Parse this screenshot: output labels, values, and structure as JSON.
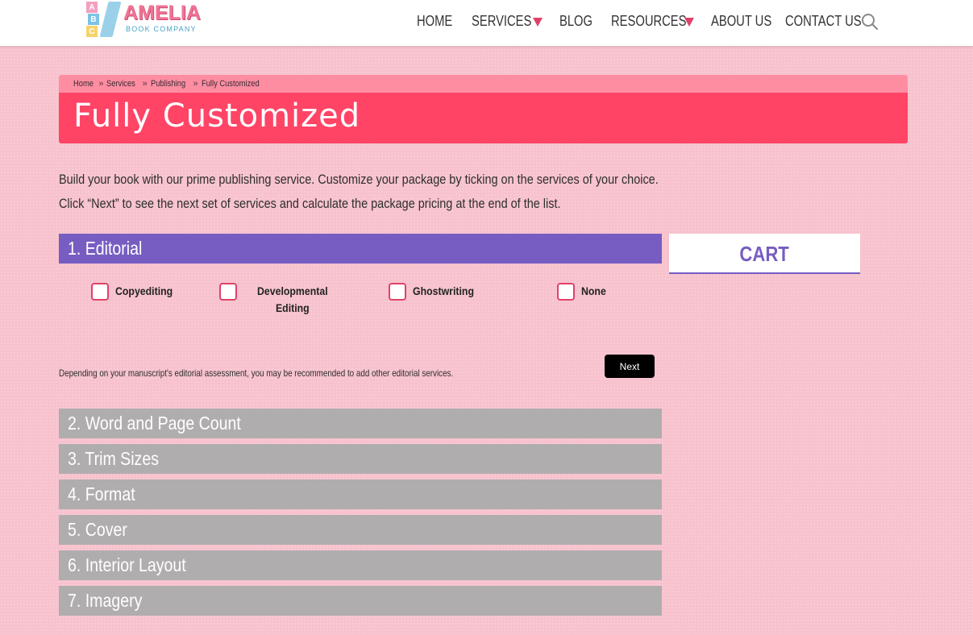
{
  "colors": {
    "page_bg": "#f7c2cd",
    "breadcrumb_bg": "#ff8da2",
    "title_bg": "#ff4466",
    "active_section": "#775dc2",
    "collapsed_section": "#b0adae",
    "caret": "#e0416a",
    "checkbox_border": "#e0416a"
  },
  "logo": {
    "blocks": [
      "A",
      "B",
      "C"
    ],
    "title": "AMELIA",
    "subtitle": "BOOK COMPANY"
  },
  "nav": {
    "items": [
      {
        "label": "HOME",
        "dropdown": false
      },
      {
        "label": "SERVICES",
        "dropdown": true
      },
      {
        "label": "BLOG",
        "dropdown": false
      },
      {
        "label": "RESOURCES",
        "dropdown": true
      },
      {
        "label": "ABOUT US",
        "dropdown": false
      },
      {
        "label": "CONTACT US",
        "dropdown": false
      }
    ],
    "search_icon": "search-icon"
  },
  "breadcrumb": {
    "items": [
      "Home",
      "Services",
      "Publishing",
      "Fully Customized"
    ],
    "separator": "»"
  },
  "page": {
    "title": "Fully Customized",
    "intro_line1": "Build your book with our prime publishing service. Customize your package by ticking on the services of your choice.",
    "intro_line2": "Click “Next” to see the next set of services and calculate the package pricing at the end of the list."
  },
  "sections": [
    {
      "label": "1. Editorial",
      "expanded": true,
      "options": [
        {
          "label": "Copyediting",
          "checked": false
        },
        {
          "label_line1": "Developmental",
          "label_line2": "Editing",
          "checked": false
        },
        {
          "label": "Ghostwriting",
          "checked": false
        },
        {
          "label": "None",
          "checked": false
        }
      ],
      "note": "Depending on your manuscript's editorial assessment, you may be recommended to add other editorial services.",
      "next_label": "Next"
    },
    {
      "label": "2. Word and Page Count",
      "expanded": false
    },
    {
      "label": "3. Trim Sizes",
      "expanded": false
    },
    {
      "label": "4. Format",
      "expanded": false
    },
    {
      "label": "5. Cover",
      "expanded": false
    },
    {
      "label": "6. Interior Layout",
      "expanded": false
    },
    {
      "label": "7. Imagery",
      "expanded": false
    }
  ],
  "cart": {
    "label": "CART"
  }
}
